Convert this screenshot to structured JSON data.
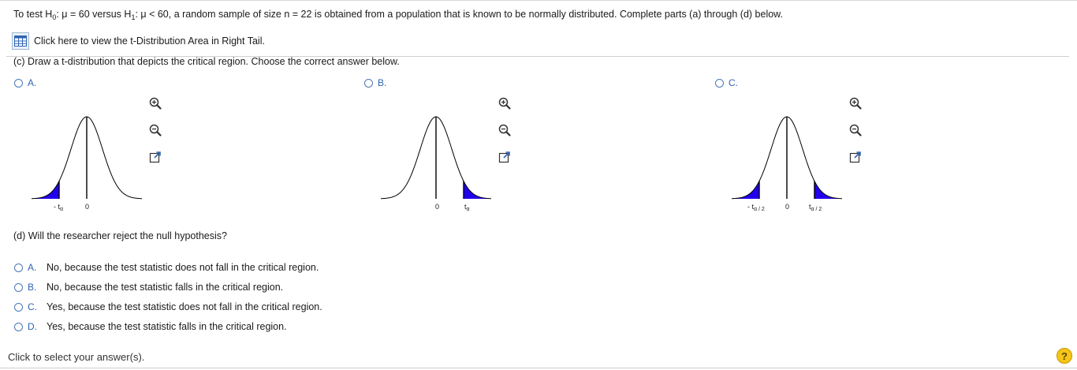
{
  "question": {
    "prefix": "To test H",
    "h0_sub": "0",
    "h0_rest": ": μ = 60 versus H",
    "h1_sub": "1",
    "h1_rest": ": μ < 60, a random sample of size n = 22 is obtained from a population that is known to be normally distributed. Complete parts (a) through (d) below."
  },
  "table_link": {
    "label": "Click here to view the t-Distribution Area in Right Tail.",
    "icon": "table-icon"
  },
  "part_c": {
    "prompt": "(c) Draw a t-distribution that depicts the critical region. Choose the correct answer below.",
    "options": [
      {
        "letter": "A.",
        "tail": "left",
        "labels": [
          {
            "main": "- t",
            "sub": "α"
          },
          {
            "main": "0",
            "sub": ""
          }
        ]
      },
      {
        "letter": "B.",
        "tail": "right",
        "labels": [
          {
            "main": "0",
            "sub": ""
          },
          {
            "main": "t",
            "sub": "α"
          }
        ]
      },
      {
        "letter": "C.",
        "tail": "both",
        "labels": [
          {
            "main": "- t",
            "sub": "α / 2"
          },
          {
            "main": "0",
            "sub": ""
          },
          {
            "main": "t",
            "sub": "α / 2"
          }
        ]
      }
    ],
    "tools": [
      "zoom-in-icon",
      "zoom-out-icon",
      "popout-icon"
    ]
  },
  "part_d": {
    "prompt": "(d) Will the researcher reject the null hypothesis?",
    "options": [
      {
        "letter": "A.",
        "text": "No, because the test statistic does not fall in the critical region."
      },
      {
        "letter": "B.",
        "text": "No, because the test statistic falls in the critical region."
      },
      {
        "letter": "C.",
        "text": "Yes, because the test statistic does not fall in the critical region."
      },
      {
        "letter": "D.",
        "text": "Yes, because the test statistic falls in the critical region."
      }
    ]
  },
  "footer": {
    "text": "Click to select your answer(s).",
    "help": "?"
  },
  "colors": {
    "accent": "#2f64b0",
    "shade": "#2200ee",
    "help": "#f5c518"
  }
}
